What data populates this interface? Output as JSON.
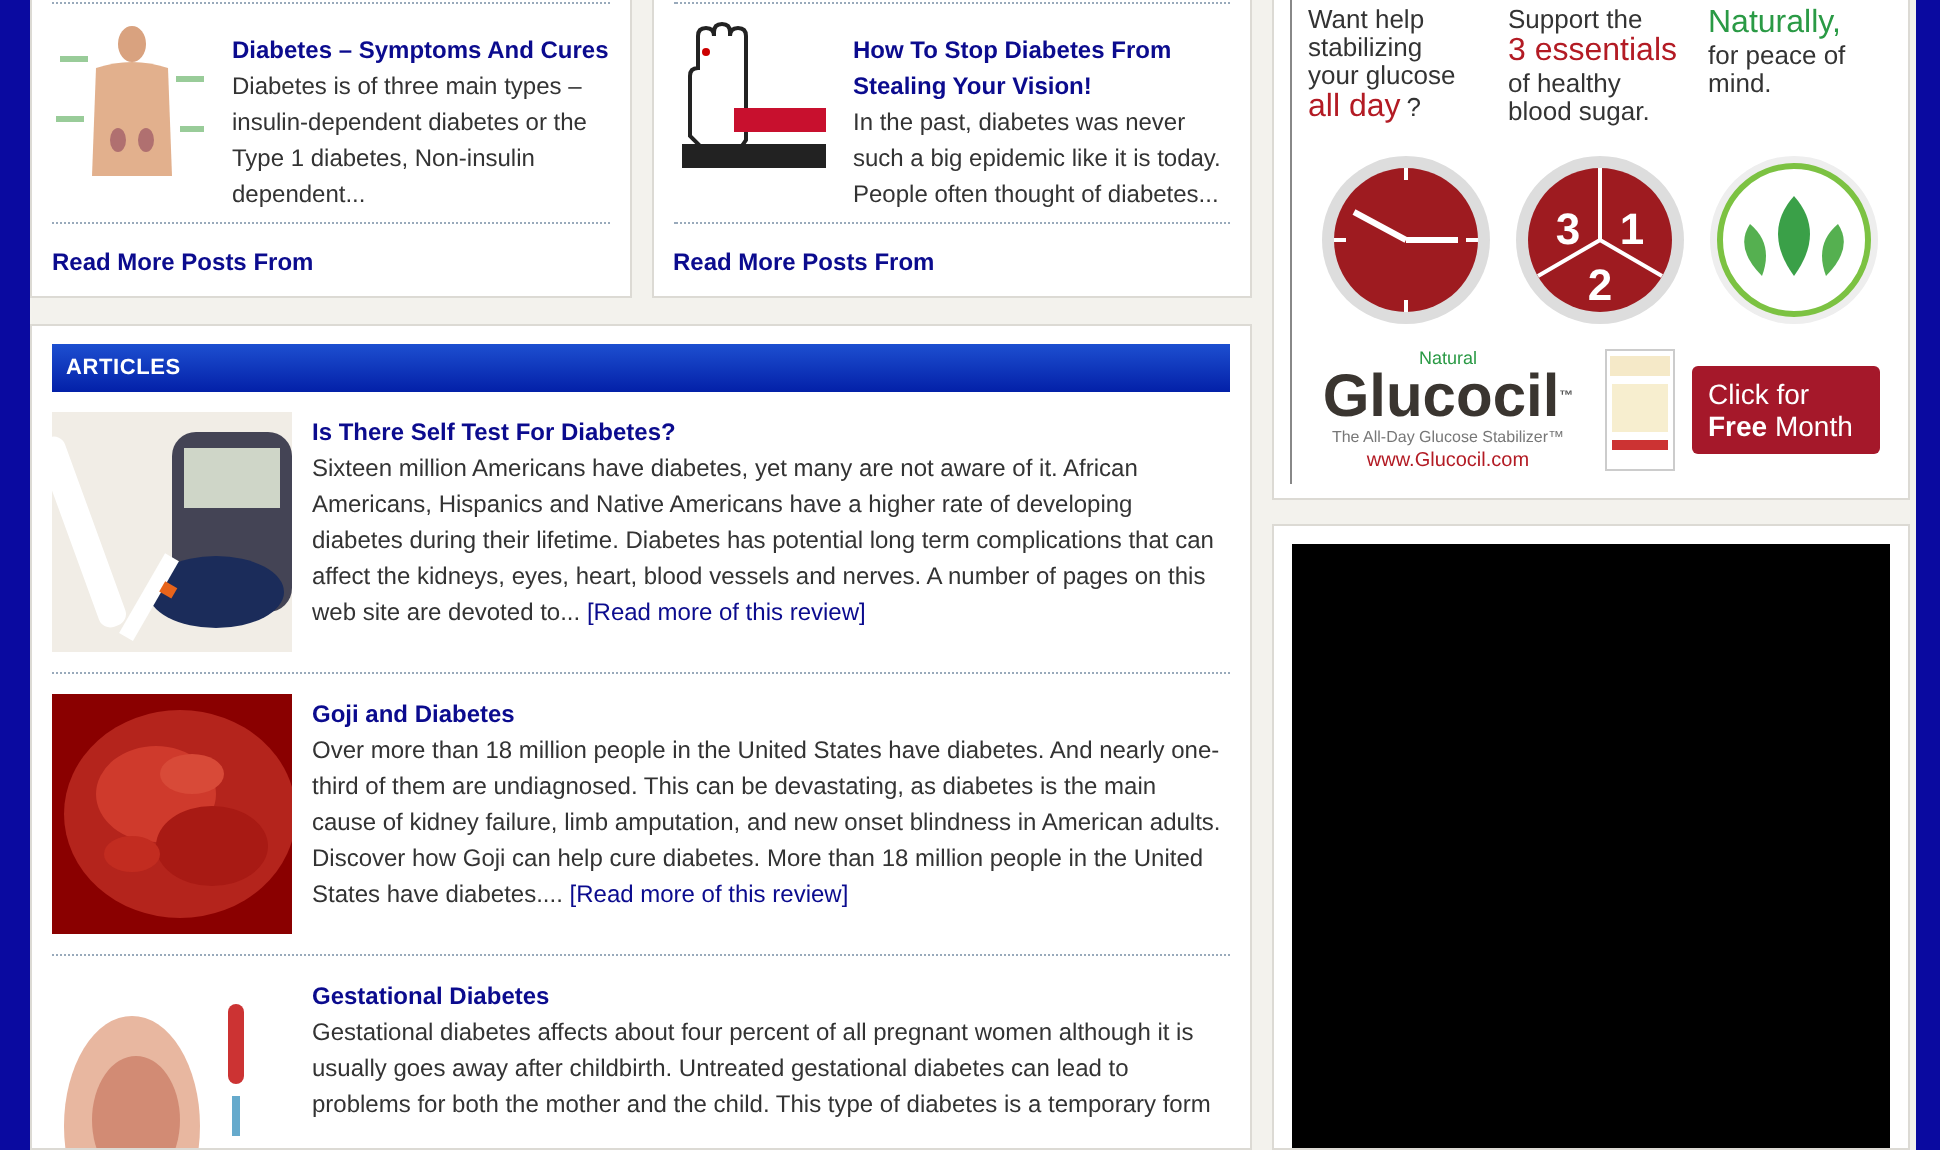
{
  "top_posts": [
    {
      "title": "Diabetes – Symptoms And Cures",
      "excerpt": "Diabetes is of three main types – insulin-dependent diabetes or the Type 1 diabetes, Non-insulin dependent...",
      "more": "Read More Posts From"
    },
    {
      "title": "How To Stop Diabetes From Stealing Your Vision!",
      "excerpt": "In the past, diabetes was never such a big epidemic like it is today. People often thought of diabetes...",
      "more": "Read More Posts From"
    }
  ],
  "articles": {
    "heading": "ARTICLES",
    "items": [
      {
        "title": "Is There Self Test For Diabetes?",
        "excerpt": "Sixteen million Americans have diabetes, yet many are not aware of it. African Americans, Hispanics and Native Americans have a higher rate of developing diabetes during their lifetime. Diabetes has potential long term complications that can affect the kidneys, eyes, heart, blood vessels and nerves. A number of pages on this web site are devoted to...",
        "link": "[Read more of this review]"
      },
      {
        "title": "Goji and Diabetes",
        "excerpt": "Over more than 18 million people in the United States have diabetes. And nearly one-third of them are undiagnosed. This can be devastating, as diabetes is the main cause of kidney failure, limb amputation, and new onset blindness in American adults. Discover how Goji can help cure diabetes. More than 18 million people in the United States have diabetes....",
        "link": "[Read more of this review]"
      },
      {
        "title": "Gestational Diabetes",
        "excerpt": "Gestational diabetes affects about four percent of all pregnant women although it is usually goes away after childbirth. Untreated gestational diabetes can lead to problems for both the mother and the child. This type of diabetes is a temporary form"
      }
    ]
  },
  "ad": {
    "columns": [
      {
        "parts": [
          {
            "kind": "plain",
            "text": "Want help stabilizing your glucose"
          },
          {
            "kind": "red",
            "text": "all day"
          },
          {
            "kind": "plain",
            "text": "?"
          }
        ]
      },
      {
        "parts": [
          {
            "kind": "plain",
            "text": "Support the"
          },
          {
            "kind": "red",
            "text": "3 essentials"
          },
          {
            "kind": "plain",
            "text": "of healthy blood sugar."
          }
        ]
      },
      {
        "parts": [
          {
            "kind": "green",
            "text": "Naturally,"
          },
          {
            "kind": "plain",
            "text": "for peace of mind."
          }
        ]
      }
    ],
    "numbers": [
      "3",
      "1",
      "2"
    ],
    "brand_note": "Natural",
    "brand": "Glucocil",
    "trademark": "™",
    "tagline": "The All-Day Glucose Stabilizer™",
    "url": "www.Glucocil.com",
    "cta": [
      "Click for",
      "**Free** Month"
    ]
  }
}
